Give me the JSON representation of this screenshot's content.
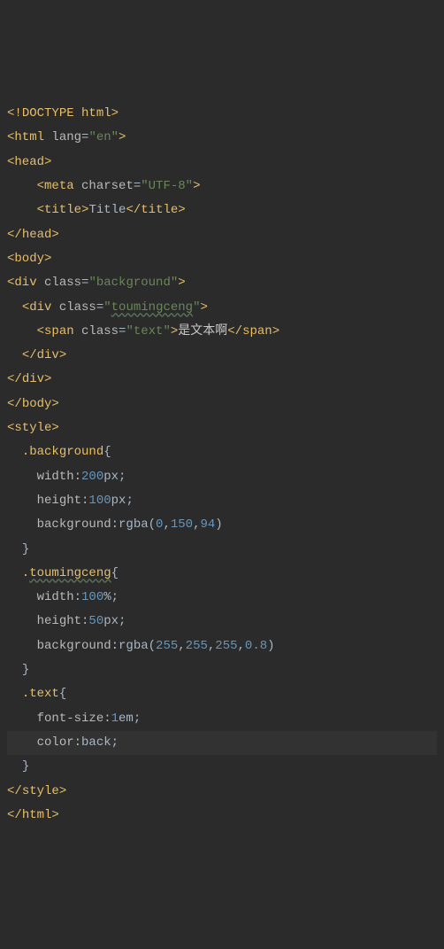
{
  "code": {
    "l01": {
      "open": "<!",
      "doctype": "DOCTYPE ",
      "html": "html",
      "close": ">"
    },
    "l02": {
      "open": "<",
      "tag": "html ",
      "attr": "lang",
      "eq": "=",
      "val": "\"en\"",
      "close": ">"
    },
    "l03": {
      "open": "<",
      "tag": "head",
      "close": ">"
    },
    "l04": {
      "indent": "    ",
      "open": "<",
      "tag": "meta ",
      "attr": "charset",
      "eq": "=",
      "val": "\"UTF-8\"",
      "close": ">"
    },
    "l05": {
      "indent": "    ",
      "open1": "<",
      "tag1": "title",
      "close1": ">",
      "text": "Title",
      "open2": "</",
      "tag2": "title",
      "close2": ">"
    },
    "l06": {
      "open": "</",
      "tag": "head",
      "close": ">"
    },
    "l07": {
      "open": "<",
      "tag": "body",
      "close": ">"
    },
    "l08": {
      "open": "<",
      "tag": "div ",
      "attr": "class",
      "eq": "=",
      "val": "\"background\"",
      "close": ">"
    },
    "l09": {
      "indent": "  ",
      "open": "<",
      "tag": "div ",
      "attr": "class",
      "eq": "=",
      "q": "\"",
      "val": "toumingceng",
      "q2": "\"",
      "close": ">"
    },
    "l10": {
      "indent": "    ",
      "open1": "<",
      "tag1": "span ",
      "attr": "class",
      "eq": "=",
      "val": "\"text\"",
      "close1": ">",
      "text": "是文本啊",
      "open2": "</",
      "tag2": "span",
      "close2": ">"
    },
    "l11": {
      "indent": "  ",
      "open": "</",
      "tag": "div",
      "close": ">"
    },
    "l12": {
      "open": "</",
      "tag": "div",
      "close": ">"
    },
    "l13": {
      "open": "</",
      "tag": "body",
      "close": ">"
    },
    "l14": {
      "open": "<",
      "tag": "style",
      "close": ">"
    },
    "l15": {
      "indent": "  ",
      "sel": ".background",
      "b": "{"
    },
    "l16": {
      "indent": "    ",
      "prop": "width:",
      "num": "200",
      "unit": "px;"
    },
    "l17": {
      "indent": "    ",
      "prop": "height:",
      "num": "100",
      "unit": "px;"
    },
    "l18": {
      "indent": "    ",
      "prop": "background:",
      "fn": "rgba(",
      "n1": "0",
      "c1": ",",
      "n2": "150",
      "c2": ",",
      "n3": "94",
      "p": ")"
    },
    "l19": {
      "indent": "  ",
      "b": "}"
    },
    "l20": {
      "indent": "  .",
      "sel": "toumingceng",
      "b": "{"
    },
    "l21": {
      "indent": "    ",
      "prop": "width:",
      "num": "100",
      "unit": "%;"
    },
    "l22": {
      "indent": "    ",
      "prop": "height:",
      "num": "50",
      "unit": "px;"
    },
    "l23": {
      "indent": "    ",
      "prop": "background:",
      "fn": "rgba(",
      "n1": "255",
      "c1": ",",
      "n2": "255",
      "c2": ",",
      "n3": "255",
      "c3": ",",
      "n4": "0.8",
      "p": ")"
    },
    "l24": {
      "indent": "  ",
      "b": "}"
    },
    "l25": {
      "indent": "  ",
      "sel": ".text",
      "b": "{"
    },
    "l26": {
      "indent": "    ",
      "prop": "font-size:",
      "num": "1",
      "unit": "em;"
    },
    "l27": {
      "indent": "    ",
      "prop": "color:",
      "val": "back;"
    },
    "l28": {
      "indent": "  ",
      "b": "}"
    },
    "l29": {
      "open": "</",
      "tag": "style",
      "close": ">"
    },
    "l30": {
      "open": "</",
      "tag": "html",
      "close": ">"
    }
  }
}
